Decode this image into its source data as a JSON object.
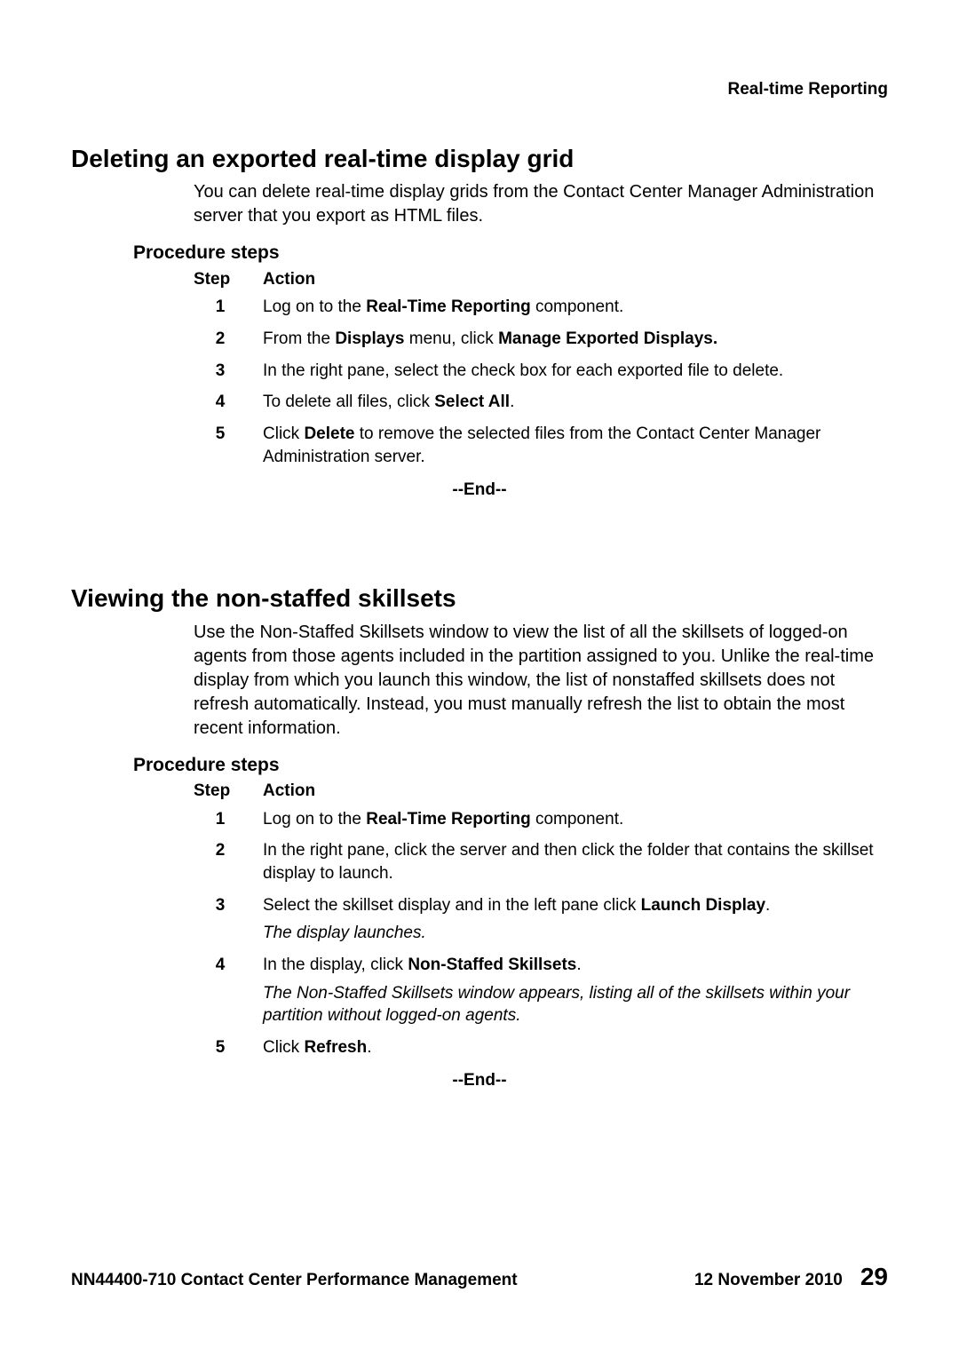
{
  "header": {
    "running_title": "Real-time Reporting"
  },
  "section1": {
    "title": "Deleting an exported real-time display grid",
    "intro": "You can delete real-time display grids from the Contact Center Manager Administration server that you export as HTML files.",
    "proc_heading": "Procedure steps",
    "table_header": {
      "step": "Step",
      "action": "Action"
    },
    "steps": {
      "s1": {
        "num": "1",
        "pre": "Log on to the ",
        "b1": "Real-Time Reporting",
        "post": " component."
      },
      "s2": {
        "num": "2",
        "pre": "From the ",
        "b1": "Displays",
        "mid": " menu, click ",
        "b2": "Manage Exported Displays."
      },
      "s3": {
        "num": "3",
        "text": "In the right pane, select the check box for each exported file to delete."
      },
      "s4": {
        "num": "4",
        "pre": "To delete all files, click ",
        "b1": "Select All",
        "post": "."
      },
      "s5": {
        "num": "5",
        "pre": "Click ",
        "b1": "Delete",
        "post": " to remove the selected files from the Contact Center Manager Administration server."
      }
    },
    "end": "--End--"
  },
  "section2": {
    "title": "Viewing the non-staffed skillsets",
    "intro": "Use the Non-Staffed Skillsets window to view the list of all the skillsets of logged-on agents from those agents included in the partition assigned to you. Unlike the real-time display from which you launch this window, the list of nonstaffed skillsets does not refresh automatically. Instead, you must manually refresh the list to obtain the most recent information.",
    "proc_heading": "Procedure steps",
    "table_header": {
      "step": "Step",
      "action": "Action"
    },
    "steps": {
      "s1": {
        "num": "1",
        "pre": "Log on to the ",
        "b1": "Real-Time Reporting",
        "post": " component."
      },
      "s2": {
        "num": "2",
        "text": "In the right pane, click the server and then click the folder that contains the skillset display to launch."
      },
      "s3": {
        "num": "3",
        "pre": "Select the skillset display and in the left pane click ",
        "b1": "Launch Display",
        "post": ".",
        "result": "The display launches."
      },
      "s4": {
        "num": "4",
        "pre": "In the display, click ",
        "b1": "Non-Staffed Skillsets",
        "post": ".",
        "result": "The Non-Staffed Skillsets window appears, listing all of the skillsets within your partition without logged-on agents."
      },
      "s5": {
        "num": "5",
        "pre": "Click ",
        "b1": "Refresh",
        "post": "."
      }
    },
    "end": "--End--"
  },
  "footer": {
    "doc_id": "NN44400-710 Contact Center Performance Management",
    "date": "12 November 2010",
    "page": "29"
  }
}
